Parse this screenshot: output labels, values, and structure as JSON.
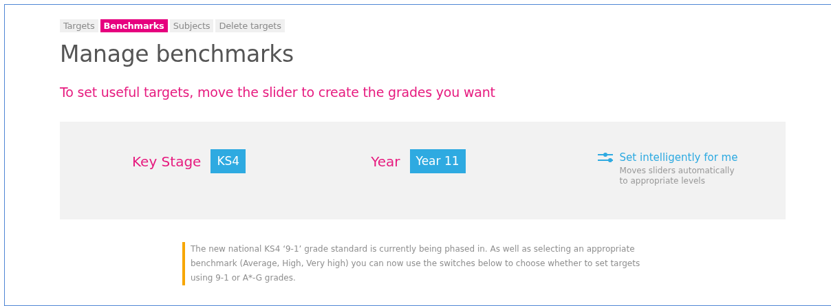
{
  "tabs": [
    {
      "label": "Targets",
      "selected": false
    },
    {
      "label": "Benchmarks",
      "selected": true
    },
    {
      "label": "Subjects",
      "selected": false
    },
    {
      "label": "Delete targets",
      "selected": false
    }
  ],
  "title": "Manage benchmarks",
  "subtitle": "To set useful targets, move the slider to create the grades you want",
  "panel": {
    "key_stage": {
      "label": "Key Stage",
      "value": "KS4"
    },
    "year": {
      "label": "Year",
      "value": "Year 11"
    },
    "auto": {
      "link": "Set intelligently for me",
      "description": "Moves sliders automatically to appropriate levels"
    }
  },
  "notice": "The new national KS4 ‘9-1’ grade standard is currently being phased in. As well as selecting an appropriate benchmark (Average, High, Very high) you can now use the switches below to choose whether to set targets using 9-1 or A*-G grades."
}
